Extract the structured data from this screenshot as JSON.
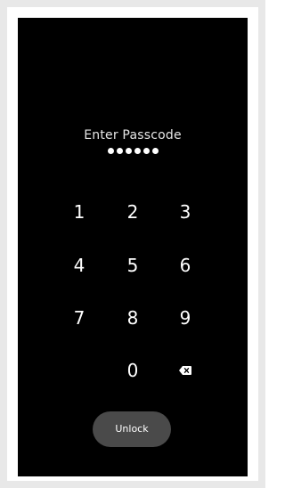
{
  "lock_screen": {
    "prompt": "Enter Passcode",
    "entered_digits_count": 6,
    "keypad": {
      "row1": [
        "1",
        "2",
        "3"
      ],
      "row2": [
        "4",
        "5",
        "6"
      ],
      "row3": [
        "7",
        "8",
        "9"
      ],
      "zero": "0",
      "backspace_icon": "backspace-icon"
    },
    "unlock_label": "Unlock"
  },
  "colors": {
    "screen_bg": "#000000",
    "button_bg": "#4a4a4a",
    "text": "#ffffff"
  }
}
